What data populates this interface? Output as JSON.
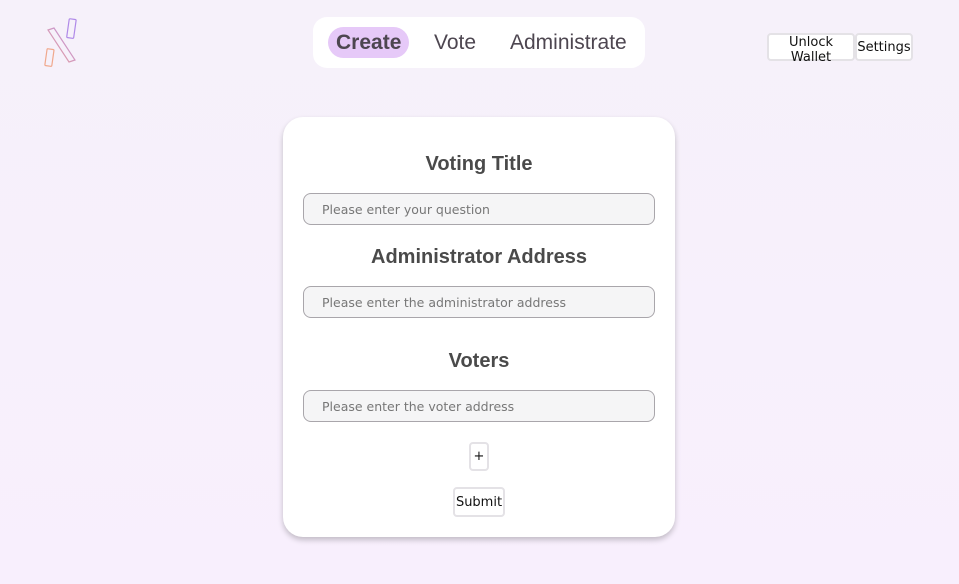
{
  "header": {
    "logo_icon": "x-logo-icon",
    "tabs": [
      {
        "label": "Create",
        "active": true
      },
      {
        "label": "Vote",
        "active": false
      },
      {
        "label": "Administrate",
        "active": false
      }
    ],
    "unlock_wallet_label": "Unlock Wallet",
    "settings_label": "Settings"
  },
  "form": {
    "title_heading": "Voting Title",
    "title_placeholder": "Please enter your question",
    "admin_heading": "Administrator Address",
    "admin_placeholder": "Please enter the administrator address",
    "voters_heading": "Voters",
    "voter_placeholder": "Please enter the voter address",
    "add_label": "+",
    "submit_label": "Submit"
  },
  "colors": {
    "accent": "#e6c9f8",
    "background": "#f6f1fa"
  }
}
